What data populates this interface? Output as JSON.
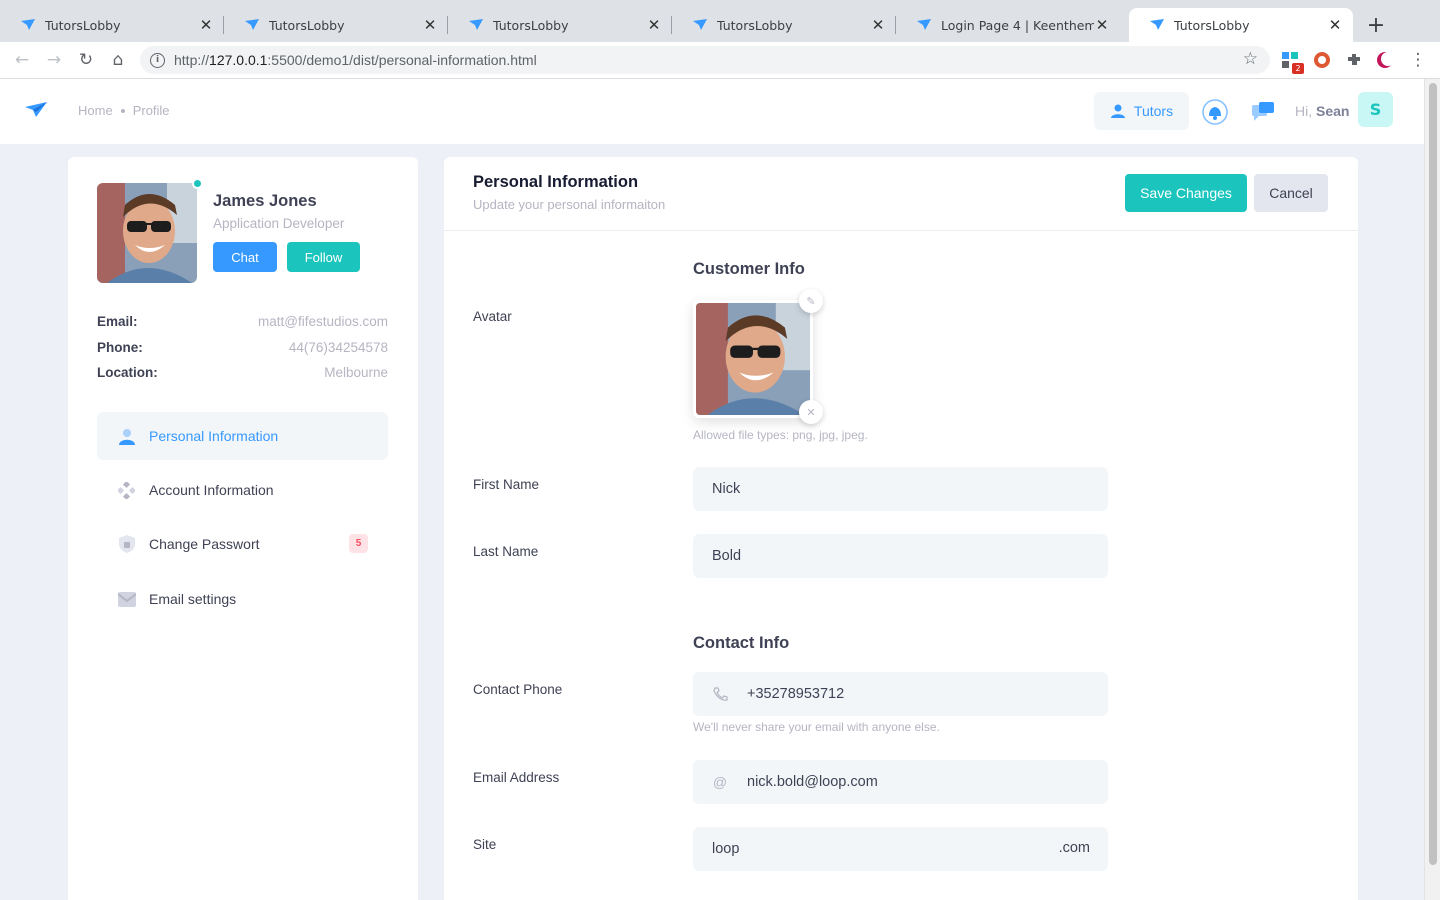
{
  "browser": {
    "tabs": [
      {
        "title": "TutorsLobby",
        "active": false
      },
      {
        "title": "TutorsLobby",
        "active": false
      },
      {
        "title": "TutorsLobby",
        "active": false
      },
      {
        "title": "TutorsLobby",
        "active": false
      },
      {
        "title": "Login Page 4 | Keenthemes",
        "active": false
      },
      {
        "title": "TutorsLobby",
        "active": true
      }
    ],
    "url_prefix": "http://",
    "url_host": "127.0.0.1",
    "url_path": ":5500/demo1/dist/personal-information.html",
    "extension_badge": "2"
  },
  "header": {
    "breadcrumb": [
      "Home",
      "Profile"
    ],
    "tutors_label": "Tutors",
    "greeting": "Hi,",
    "user_name": "Sean",
    "user_initial": "S",
    "accent": "#3699ff",
    "success": "#1bc5bd"
  },
  "profile": {
    "name": "James Jones",
    "role": "Application Developer",
    "chat_label": "Chat",
    "follow_label": "Follow",
    "details": [
      {
        "key": "Email:",
        "value": "matt@fifestudios.com"
      },
      {
        "key": "Phone:",
        "value": "44(76)34254578"
      },
      {
        "key": "Location:",
        "value": "Melbourne"
      }
    ],
    "nav": [
      {
        "label": "Personal Information",
        "icon": "user-icon",
        "active": true
      },
      {
        "label": "Account Information",
        "icon": "layout-icon",
        "active": false
      },
      {
        "label": "Change Passwort",
        "icon": "shield-icon",
        "active": false,
        "badge": "5"
      },
      {
        "label": "Email settings",
        "icon": "mail-icon",
        "active": false
      }
    ]
  },
  "form": {
    "title": "Personal Information",
    "subtitle": "Update your personal informaiton",
    "save_label": "Save Changes",
    "cancel_label": "Cancel",
    "customer_section": "Customer Info",
    "avatar_label": "Avatar",
    "avatar_hint": "Allowed file types: png, jpg, jpeg.",
    "first_name_label": "First Name",
    "first_name": "Nick",
    "last_name_label": "Last Name",
    "last_name": "Bold",
    "contact_section": "Contact Info",
    "phone_label": "Contact Phone",
    "phone": "+35278953712",
    "phone_hint": "We'll never share your email with anyone else.",
    "email_label": "Email Address",
    "email_icon": "@",
    "email": "nick.bold@loop.com",
    "site_label": "Site",
    "site": "loop",
    "site_suffix": ".com"
  }
}
